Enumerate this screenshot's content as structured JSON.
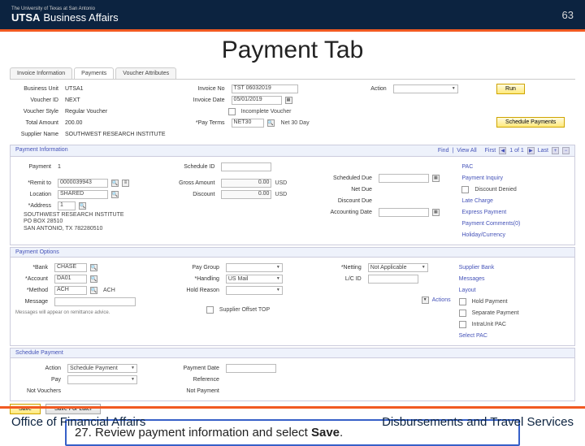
{
  "header": {
    "university": "The University of Texas at San Antonio",
    "utsa": "UTSA",
    "biz": "Business Affairs",
    "page_num": "63"
  },
  "title": "Payment Tab",
  "tabs": {
    "invoice": "Invoice Information",
    "payments": "Payments",
    "voucher_attr": "Voucher Attributes"
  },
  "top": {
    "bu_lbl": "Business Unit",
    "bu_val": "UTSA1",
    "vid_lbl": "Voucher ID",
    "vid_val": "NEXT",
    "vstyle_lbl": "Voucher Style",
    "vstyle_val": "Regular Voucher",
    "total_lbl": "Total Amount",
    "total_val": "200.00",
    "sname_lbl": "Supplier Name",
    "sname_val": "SOUTHWEST RESEARCH INSTITUTE",
    "invno_lbl": "Invoice No",
    "invno_val": "TST 06032019",
    "invdate_lbl": "Invoice Date",
    "invdate_val": "05/01/2019",
    "incomp_lbl": "Incomplete Voucher",
    "payterms_lbl": "*Pay Terms",
    "payterms_val": "NET30",
    "payterms_txt": "Net 30 Day",
    "action_lbl": "Action",
    "run_btn": "Run",
    "sched_btn": "Schedule Payments"
  },
  "pi": {
    "title": "Payment Information",
    "find": "Find",
    "viewall": "View All",
    "first": "First",
    "count": "1 of 1",
    "last": "Last",
    "payment_lbl": "Payment",
    "payment_val": "1",
    "remit_lbl": "*Remit to",
    "remit_val": "0000039943",
    "loc_lbl": "Location",
    "loc_val": "SHARED",
    "addr_lbl": "*Address",
    "addr_val": "1",
    "addr1": "SOUTHWEST RESEARCH INSTITUTE",
    "addr2": "PO BOX 28510",
    "addr3": "SAN ANTONIO, TX 782280510",
    "schid_lbl": "Schedule ID",
    "gross_lbl": "Gross Amount",
    "gross_val": "0.00",
    "gross_cur": "USD",
    "disc_lbl": "Discount",
    "disc_val": "0.00",
    "disc_cur": "USD",
    "sdate_lbl": "Scheduled Due",
    "ndate_lbl": "Net Due",
    "ddate_lbl": "Discount Due",
    "adate_lbl": "Accounting Date",
    "pinq": "Payment Inquiry",
    "dd": "Discount Denied",
    "lc": "Late Charge",
    "ep": "Express Payment",
    "pc": "Payment Comments(0)",
    "hc": "Holiday/Currency"
  },
  "po": {
    "title": "Payment Options",
    "bank_lbl": "*Bank",
    "bank_val": "CHASE",
    "acct_lbl": "*Account",
    "acct_val": "DA01",
    "method_lbl": "*Method",
    "method_val": "ACH",
    "method_txt": "ACH",
    "msg_lbl": "Message",
    "msg_help": "Messages will appear on remittance advice.",
    "pg_lbl": "Pay Group",
    "handling_lbl": "*Handling",
    "handling_val": "US Mail",
    "hr_lbl": "Hold Reason",
    "sot_lbl": "Supplier Offset TOP",
    "netting_lbl": "*Netting",
    "netting_val": "Not Applicable",
    "lc_lbl": "L/C ID",
    "actions_lbl": "Actions",
    "sbl": "Supplier Bank",
    "msgs": "Messages",
    "layout": "Layout",
    "hold": "Hold Payment",
    "sep": "Separate Payment",
    "intra": "IntraUnit PAC",
    "select_pac": "Select  PAC",
    "pac": "PAC"
  },
  "sp": {
    "title": "Schedule Payment",
    "action_lbl": "Action",
    "action_val": "Schedule Payment",
    "pay_lbl": "Pay",
    "nv_lbl": "Not Vouchers",
    "pd_lbl": "Payment Date",
    "ref_lbl": "Reference",
    "np_lbl": "Not Payment"
  },
  "bottom": {
    "save": "Save",
    "sfl": "Save For Later"
  },
  "callout_pre": "27. Review payment information and select ",
  "callout_b": "Save",
  "callout_post": ".",
  "footer": {
    "left": "Office of Financial Affairs",
    "right": "Disbursements and Travel Services"
  }
}
